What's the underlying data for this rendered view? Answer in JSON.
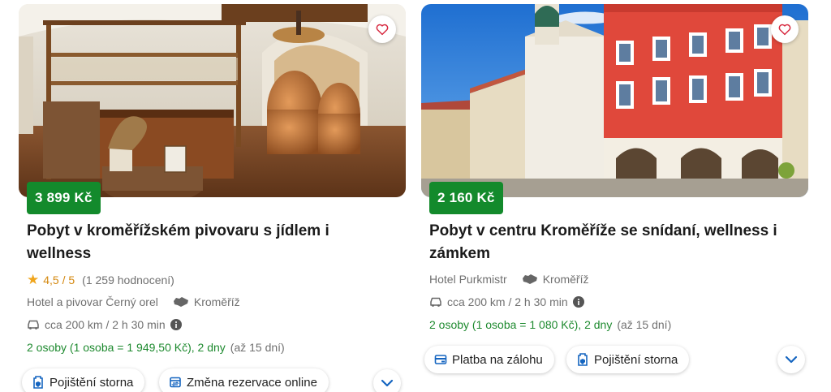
{
  "cards": [
    {
      "price": "3 899 Kč",
      "title": "Pobyt v kroměřížském pivovaru s jídlem i wellness",
      "rating": "4,5 / 5",
      "reviews": "(1 259 hodnocení)",
      "hotel": "Hotel a pivovar Černý orel",
      "city": "Kroměříž",
      "distance": "cca 200 km / 2 h 30 min",
      "offer": "2 osoby (1 osoba = 1 949,50 Kč), 2 dny",
      "offer_note": "(až 15 dní)",
      "pills": [
        "Pojištění storna",
        "Změna rezervace online"
      ],
      "icons": {
        "favorite": "heart-icon",
        "car": "car-icon",
        "region": "map-region-icon",
        "info": "info-icon",
        "insurance": "insurance-icon",
        "reschedule": "calendar-change-icon",
        "expand": "chevron-down-icon"
      }
    },
    {
      "price": "2 160 Kč",
      "title": "Pobyt v centru Kroměříže se snídaní, wellness i zámkem",
      "hotel": "Hotel Purkmistr",
      "city": "Kroměříž",
      "distance": "cca 200 km / 2 h 30 min",
      "offer": "2 osoby (1 osoba = 1 080 Kč), 2 dny",
      "offer_note": "(až 15 dní)",
      "pills": [
        "Platba na zálohu",
        "Pojištění storna"
      ],
      "icons": {
        "favorite": "heart-icon",
        "car": "car-icon",
        "region": "map-region-icon",
        "info": "info-icon",
        "deposit": "card-payment-icon",
        "insurance": "insurance-icon",
        "expand": "chevron-down-icon"
      }
    }
  ],
  "colors": {
    "price_badge": "#138a2c",
    "offer_text": "#1e8a2f",
    "rating": "#f0a51c",
    "accent": "#1565c0"
  }
}
